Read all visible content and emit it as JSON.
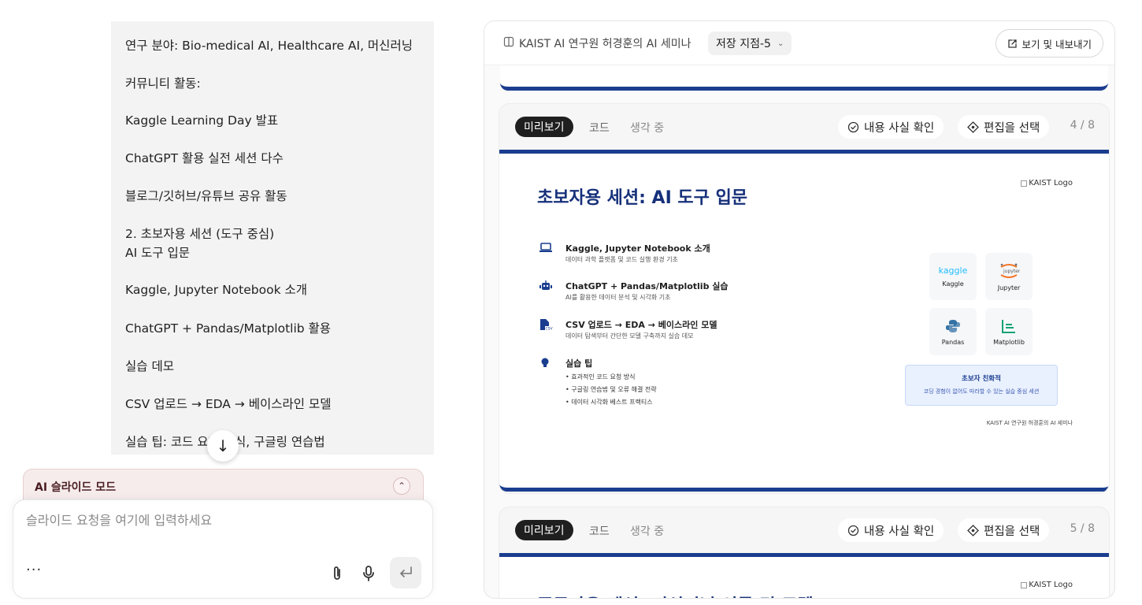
{
  "chat": {
    "lines": [
      "연구 분야: Bio-medical AI, Healthcare AI, 머신러닝",
      "커뮤니티 활동:",
      "Kaggle Learning Day 발표",
      "ChatGPT 활용 실전 세션 다수",
      "블로그/깃허브/유튜브 공유 활동",
      "2. 초보자용 세션 (도구 중심)",
      "AI 도구 입문",
      "Kaggle, Jupyter Notebook 소개",
      "ChatGPT + Pandas/Matplotlib 활용",
      "실습 데모",
      "CSV 업로드 → EDA → 베이스라인 모델",
      "실습 팁: 코드 요청 방식, 구글링 연습법"
    ],
    "scroll_down_icon": "↓"
  },
  "mode_panel": {
    "title": "AI 슬라이드 모드",
    "collapse_icon": "⌃"
  },
  "composer": {
    "placeholder": "슬라이드 요청을 여기에 입력하세요",
    "more_label": "···"
  },
  "artifact": {
    "title": "KAIST AI 연구원 허경훈의 AI 세미나",
    "version_label": "저장 지점-5",
    "version_chevron": "⌄",
    "export_label": "보기 및 내보내기",
    "cards": [
      {
        "tabs": {
          "preview": "미리보기",
          "code": "코드",
          "thinking": "생각 중"
        },
        "fact_check_label": "내용 사실 확인",
        "edit_select_label": "편집을 선택",
        "page_count": "4 / 8",
        "slide": {
          "title": "초보자용 세션: AI 도구 입문",
          "logo_alt": "KAIST Logo",
          "bullets": [
            {
              "title": "Kaggle, Jupyter Notebook 소개",
              "desc": "데이터 과학 플랫폼 및 코드 실행 환경 기초"
            },
            {
              "title": "ChatGPT + Pandas/Matplotlib 실습",
              "desc": "AI를 활용한 데이터 분석 및 시각화 기초"
            },
            {
              "title": "CSV 업로드 → EDA → 베이스라인 모델",
              "desc": "데이터 탐색부터 간단한 모델 구축까지 실습 데모"
            },
            {
              "title": "실습 팁",
              "items": [
                "• 효과적인 코드 요청 방식",
                "• 구글링 연습법 및 오류 해결 전략",
                "• 데이터 시각화 베스트 프랙티스"
              ]
            }
          ],
          "tools": [
            {
              "logo_text": "kaggle",
              "label": "Kaggle"
            },
            {
              "logo_text": "jupyter",
              "label": "Jupyter"
            },
            {
              "logo_text": "",
              "label": "Pandas"
            },
            {
              "logo_text": "",
              "label": "Matplotlib"
            }
          ],
          "friendly_title": "초보자 친화적",
          "friendly_desc": "코딩 경험이 없어도 따라할 수 있는 실습 중심 세션",
          "footer": "KAIST AI 연구원 허경훈의 AI 세미나"
        }
      },
      {
        "tabs": {
          "preview": "미리보기",
          "code": "코드",
          "thinking": "생각 중"
        },
        "fact_check_label": "내용 사실 확인",
        "edit_select_label": "편집을 선택",
        "page_count": "5 / 8",
        "slide": {
          "title": "중급자용 세션: 머신러닝 이론 및 모델",
          "logo_alt": "KAIST Logo"
        }
      }
    ]
  },
  "colors": {
    "accent_navy": "#1a3d8f",
    "mode_panel_bg": "#f6ecec",
    "dark_tab": "#1f1f1f"
  }
}
